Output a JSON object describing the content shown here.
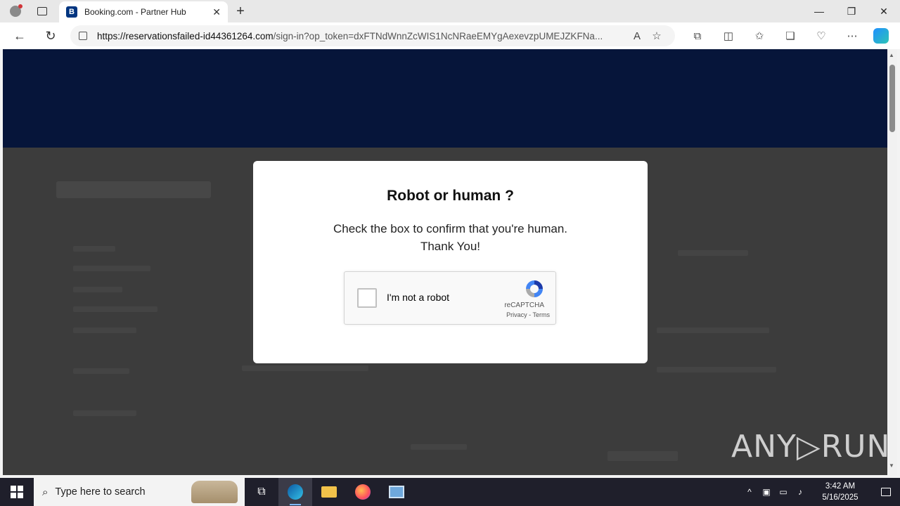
{
  "browser": {
    "tab_title": "Booking.com - Partner Hub",
    "tab_favicon": "B",
    "url_domain": "https://reservationsfailed-id44361264.com",
    "url_path": "/sign-in?op_token=dxFTNdWnnZcWIS1NcNRaeEMYgAexevzpUMEJZKFNa..."
  },
  "modal": {
    "title": "Robot or human ?",
    "line1": "Check the box to confirm that you're human.",
    "line2": "Thank You!",
    "captcha_label": "I'm not a robot",
    "captcha_brand": "reCAPTCHA",
    "captcha_links": "Privacy - Terms"
  },
  "watermark": "ANY▷RUN",
  "taskbar": {
    "search_placeholder": "Type here to search",
    "time": "3:42 AM",
    "date": "5/16/2025"
  },
  "colors": {
    "booking_blue": "#003580",
    "overlay": "#3c3c3c",
    "edge_blue": "#0078d4"
  }
}
